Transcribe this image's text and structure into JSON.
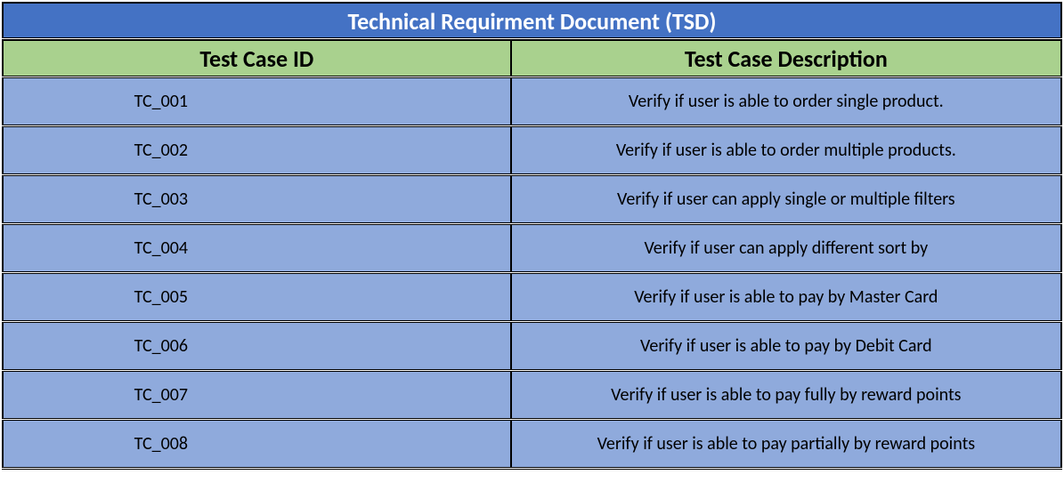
{
  "title": "Technical Requirment Document (TSD)",
  "headers": {
    "id": "Test Case ID",
    "description": "Test Case Description"
  },
  "rows": [
    {
      "id": "TC_001",
      "description": "Verify if user is able to order single product."
    },
    {
      "id": "TC_002",
      "description": "Verify if user is able to order multiple products."
    },
    {
      "id": "TC_003",
      "description": "Verify if user can apply single or multiple filters"
    },
    {
      "id": "TC_004",
      "description": "Verify if user can apply different sort by"
    },
    {
      "id": "TC_005",
      "description": "Verify if user is able to pay by Master Card"
    },
    {
      "id": "TC_006",
      "description": "Verify if user is able to pay by Debit Card"
    },
    {
      "id": "TC_007",
      "description": "Verify if user is able to pay fully by reward points"
    },
    {
      "id": "TC_008",
      "description": "Verify if user is able to pay partially by reward points"
    }
  ]
}
